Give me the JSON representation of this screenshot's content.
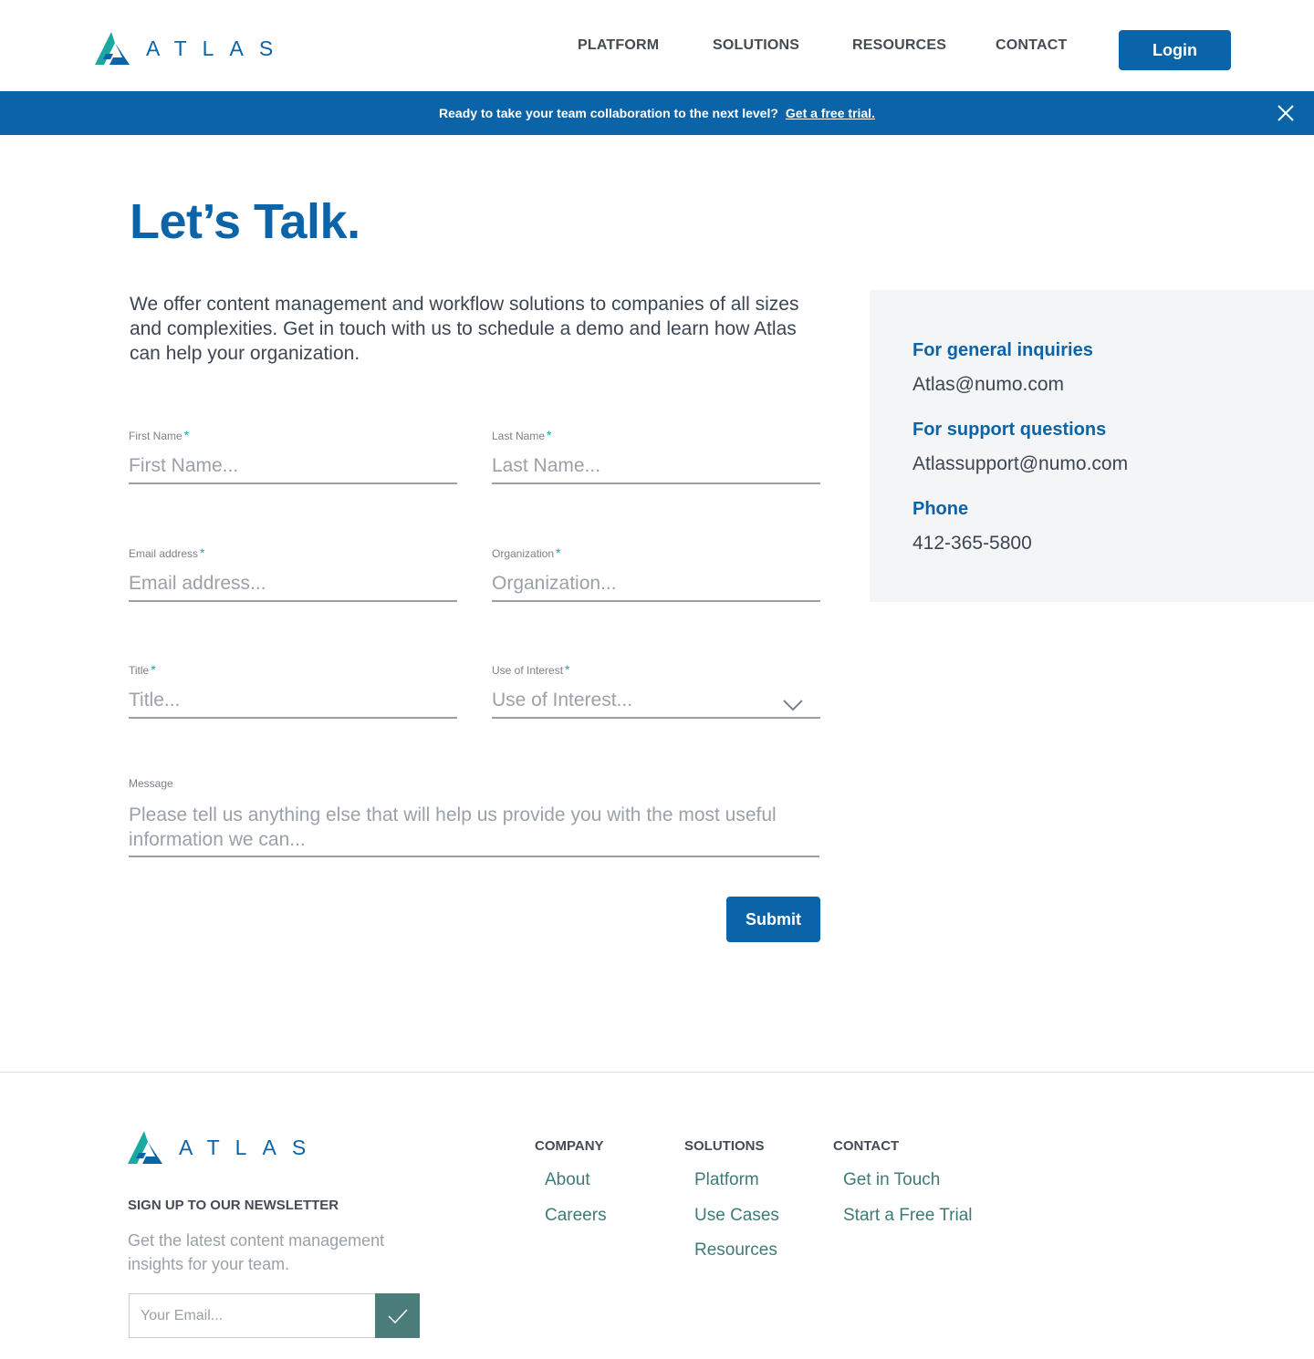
{
  "brand": {
    "name": "ATLAS",
    "color": "#0b63a8",
    "accent": "#1aa9a0"
  },
  "header": {
    "nav": [
      "PLATFORM",
      "SOLUTIONS",
      "RESOURCES",
      "CONTACT"
    ],
    "login_label": "Login"
  },
  "banner": {
    "text": "Ready to take your team collaboration to the next level?",
    "link_text": "Get a free trial.",
    "close_icon": "close-icon"
  },
  "main": {
    "title": "Let’s Talk.",
    "intro": "We offer content management and workflow solutions to companies of all sizes and complexities. Get in touch with us to schedule a demo and learn how Atlas can help your organization.",
    "form": {
      "first_name": {
        "label": "First Name",
        "placeholder": "First Name..."
      },
      "last_name": {
        "label": "Last Name",
        "placeholder": "Last Name..."
      },
      "email": {
        "label": "Email address",
        "placeholder": "Email address..."
      },
      "organization": {
        "label": "Organization",
        "placeholder": "Organization..."
      },
      "title": {
        "label": "Title",
        "placeholder": "Title..."
      },
      "use_of_interest": {
        "label": "Use of Interest",
        "placeholder": "Use of Interest..."
      },
      "message": {
        "label": "Message",
        "placeholder": "Please tell us anything else that will help us provide you with the most useful information we can..."
      },
      "required_mark": "*",
      "submit_label": "Submit"
    },
    "contact_panel": {
      "general_heading": "For general inquiries",
      "general_email": "Atlas@numo.com",
      "support_heading": "For support questions",
      "support_email": "Atlassupport@numo.com",
      "phone_heading": "Phone",
      "phone": "412-365-5800"
    }
  },
  "footer": {
    "newsletter_heading": "SIGN UP TO OUR NEWSLETTER",
    "newsletter_desc": "Get the latest content management insights for your team.",
    "email_placeholder": "Your Email...",
    "columns": [
      {
        "heading": "COMPANY",
        "links": [
          "About",
          "Careers"
        ]
      },
      {
        "heading": "SOLUTIONS",
        "links": [
          "Platform",
          "Use Cases",
          "Resources"
        ]
      },
      {
        "heading": "CONTACT",
        "links": [
          "Get in Touch",
          "Start a Free Trial"
        ]
      }
    ]
  }
}
